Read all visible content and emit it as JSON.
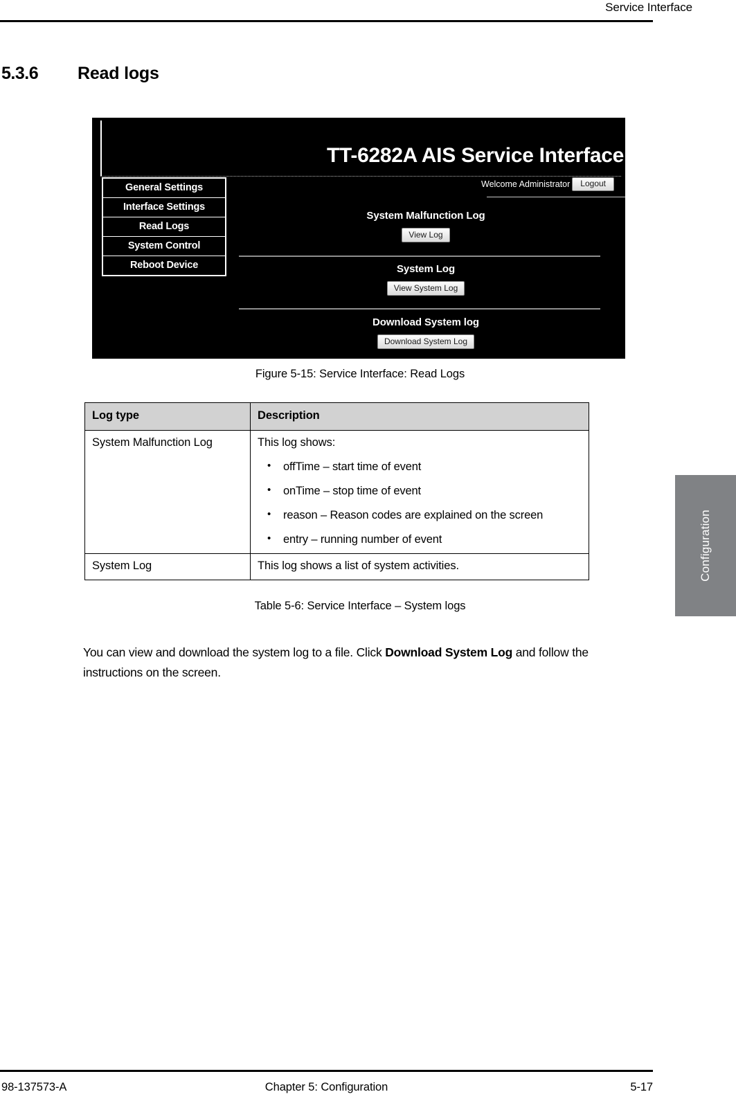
{
  "page": {
    "running_header": "Service Interface",
    "footer": {
      "doc_id": "98-137573-A",
      "chapter": "Chapter 5:  Configuration",
      "page_number": "5-17"
    },
    "side_tab_label": "Configuration"
  },
  "section": {
    "number": "5.3.6",
    "title": "Read logs"
  },
  "figure": {
    "caption": "Figure 5-15: Service Interface: Read Logs",
    "banner_title": "TT-6282A AIS Service Interface",
    "welcome_text": "Welcome Administrator !",
    "logout_label": "Logout",
    "menu_items": [
      {
        "label": "General Settings"
      },
      {
        "label": "Interface Settings"
      },
      {
        "label": "Read Logs"
      },
      {
        "label": "System Control"
      },
      {
        "label": "Reboot Device"
      }
    ],
    "blocks": [
      {
        "title": "System Malfunction Log",
        "button": "View Log"
      },
      {
        "title": "System Log",
        "button": "View System Log"
      },
      {
        "title": "Download System log",
        "button": "Download System Log"
      }
    ]
  },
  "table": {
    "caption": "Table 5-6: Service Interface – System logs",
    "headers": [
      "Log type",
      "Description"
    ],
    "rows": [
      {
        "type": "System Malfunction Log",
        "intro": "This log shows:",
        "bullets": [
          "offTime – start time of event",
          "onTime – stop time of event",
          "reason – Reason codes are explained on the screen",
          "entry – running number of event"
        ]
      },
      {
        "type": "System Log",
        "intro": "This log shows a list of system activities.",
        "bullets": []
      }
    ]
  },
  "paragraph": {
    "part1": "You can view and download the system log to a file. Click ",
    "bold": "Download System Log",
    "part2": " and follow the instructions on the screen."
  },
  "colors": {
    "table_header_bg": "#d2d2d2",
    "side_tab_bg": "#808285",
    "figure_bg": "#000000"
  }
}
